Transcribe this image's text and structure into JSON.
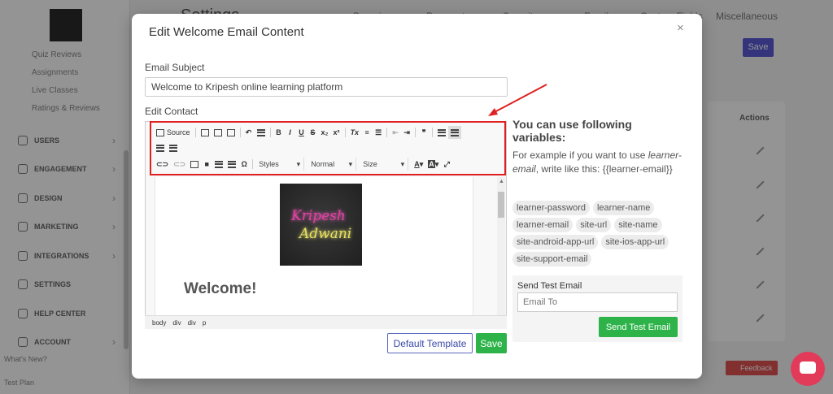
{
  "background": {
    "page_title": "Settings",
    "sidebar_subitems": [
      "Quiz Reviews",
      "Assignments",
      "Live Classes",
      "Ratings & Reviews"
    ],
    "sidebar_nav": [
      {
        "label": "USERS",
        "icon": "users-icon"
      },
      {
        "label": "ENGAGEMENT",
        "icon": "engagement-icon"
      },
      {
        "label": "DESIGN",
        "icon": "brush-icon"
      },
      {
        "label": "MARKETING",
        "icon": "trend-icon"
      },
      {
        "label": "INTEGRATIONS",
        "icon": "plug-icon"
      },
      {
        "label": "SETTINGS",
        "icon": "gear-icon"
      },
      {
        "label": "HELP CENTER",
        "icon": "help-icon"
      },
      {
        "label": "ACCOUNT",
        "icon": "account-icon"
      }
    ],
    "whats_new": "What's New?",
    "plan": "Test Plan",
    "tabs": [
      "Domain",
      "Payment",
      "Security",
      "Email",
      "Custom Fields",
      "Miscellaneous"
    ],
    "save_label": "Save",
    "actions_label": "Actions",
    "feedback_label": "Feedback"
  },
  "modal": {
    "title": "Edit Welcome Email Content",
    "close_icon": "×",
    "subject_label": "Email Subject",
    "subject_value": "Welcome to Kripesh online learning platform",
    "content_label": "Edit Contact",
    "toolbar": {
      "source_label": "Source",
      "styles_label": "Styles",
      "format_label": "Normal",
      "size_label": "Size",
      "bold": "B",
      "italic": "I",
      "underline": "U",
      "strike": "S",
      "subscript": "x₂",
      "superscript": "x²",
      "remove_format": "Tx",
      "quote": "❞",
      "omega": "Ω",
      "text_color": "A",
      "bg_color": "A",
      "maximize": "⤢"
    },
    "image_text_line1": "Kripesh",
    "image_text_line2": "Adwani",
    "welcome_heading": "Welcome!",
    "path": [
      "body",
      "div",
      "div",
      "p"
    ],
    "default_template_label": "Default Template",
    "save_label": "Save",
    "vars_title": "You can use following variables:",
    "vars_desc_prefix": "For example if you want to use",
    "vars_desc_example": "learner-email",
    "vars_desc_suffix": ", write like this: {{learner-email}}",
    "variables": [
      "learner-password",
      "learner-name",
      "learner-email",
      "site-url",
      "site-name",
      "site-android-app-url",
      "site-ios-app-url",
      "site-support-email"
    ],
    "test_email_label": "Send Test Email",
    "test_email_placeholder": "Email To",
    "send_test_label": "Send Test Email"
  },
  "colors": {
    "primary_green": "#2db34a",
    "highlight_red": "#e02020",
    "accent_blue": "#5b5bd6"
  }
}
